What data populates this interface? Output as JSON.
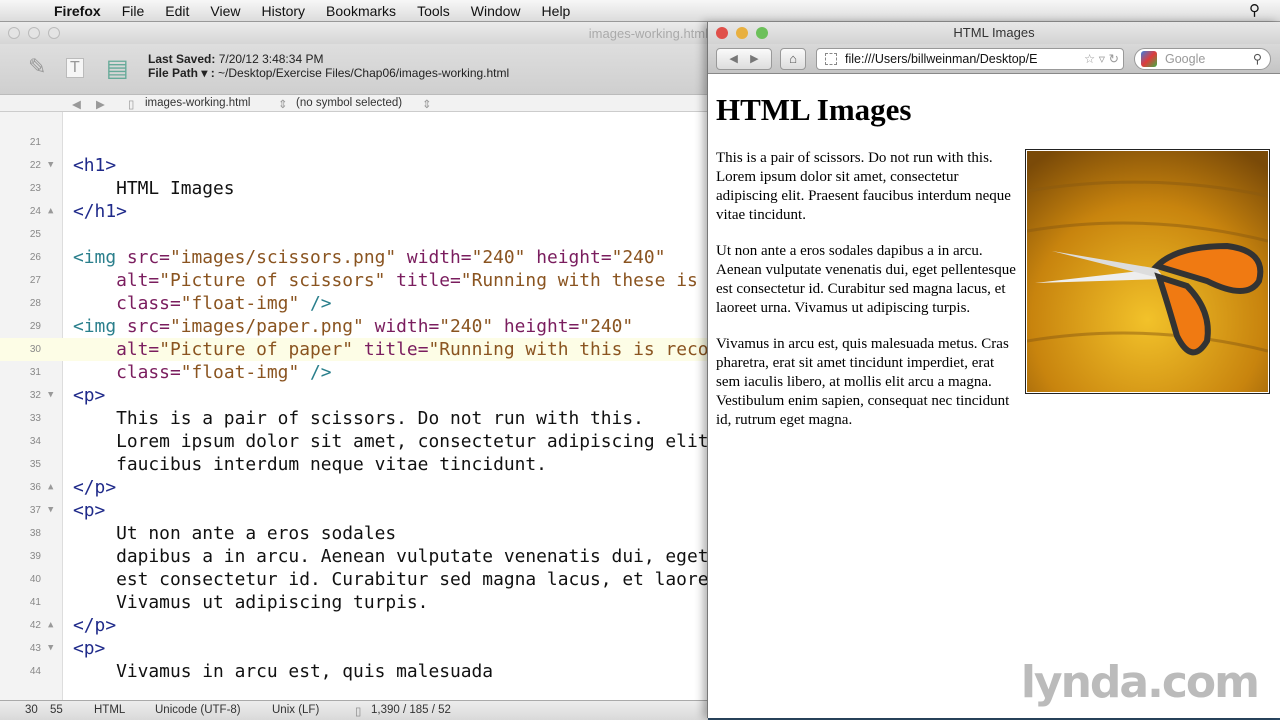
{
  "menubar": {
    "app": "Firefox",
    "items": [
      "File",
      "Edit",
      "View",
      "History",
      "Bookmarks",
      "Tools",
      "Window",
      "Help"
    ]
  },
  "editor": {
    "window_title": "images-working.html",
    "last_saved_label": "Last Saved:",
    "last_saved": "7/20/12 3:48:34 PM",
    "file_path_label": "File Path ▾ :",
    "file_path": "~/Desktop/Exercise Files/Chap06/images-working.html",
    "nav_file": "images-working.html",
    "nav_symbol": "(no symbol selected)",
    "current_line": 30,
    "lines": [
      {
        "n": 21,
        "fold": "",
        "t": []
      },
      {
        "n": 22,
        "fold": "▼",
        "t": [
          [
            "tag",
            "<h1>"
          ]
        ]
      },
      {
        "n": 23,
        "fold": "",
        "t": [
          [
            "text",
            "    HTML Images"
          ]
        ]
      },
      {
        "n": 24,
        "fold": "▲",
        "t": [
          [
            "tag",
            "</h1>"
          ]
        ]
      },
      {
        "n": 25,
        "fold": "",
        "t": []
      },
      {
        "n": 26,
        "fold": "",
        "t": [
          [
            "img",
            "<img "
          ],
          [
            "attr",
            "src="
          ],
          [
            "str",
            "\"images/scissors.png\" "
          ],
          [
            "attr",
            "width="
          ],
          [
            "str",
            "\"240\" "
          ],
          [
            "attr",
            "height="
          ],
          [
            "str",
            "\"240\""
          ]
        ]
      },
      {
        "n": 27,
        "fold": "",
        "t": [
          [
            "text",
            "    "
          ],
          [
            "attr",
            "alt="
          ],
          [
            "str",
            "\"Picture of scissors\" "
          ],
          [
            "attr",
            "title="
          ],
          [
            "str",
            "\"Running with these is"
          ]
        ]
      },
      {
        "n": 28,
        "fold": "",
        "t": [
          [
            "text",
            "    "
          ],
          [
            "attr",
            "class="
          ],
          [
            "str",
            "\"float-img\" "
          ],
          [
            "img",
            "/>"
          ]
        ]
      },
      {
        "n": 29,
        "fold": "",
        "t": [
          [
            "img",
            "<img "
          ],
          [
            "attr",
            "src="
          ],
          [
            "str",
            "\"images/paper.png\" "
          ],
          [
            "attr",
            "width="
          ],
          [
            "str",
            "\"240\" "
          ],
          [
            "attr",
            "height="
          ],
          [
            "str",
            "\"240\""
          ]
        ]
      },
      {
        "n": 30,
        "fold": "",
        "t": [
          [
            "text",
            "    "
          ],
          [
            "attr",
            "alt="
          ],
          [
            "str",
            "\"Picture of paper\" "
          ],
          [
            "attr",
            "title="
          ],
          [
            "str",
            "\"Running with this is reco"
          ]
        ]
      },
      {
        "n": 31,
        "fold": "",
        "t": [
          [
            "text",
            "    "
          ],
          [
            "attr",
            "class="
          ],
          [
            "str",
            "\"float-img\" "
          ],
          [
            "img",
            "/>"
          ]
        ]
      },
      {
        "n": 32,
        "fold": "▼",
        "t": [
          [
            "tag",
            "<p>"
          ]
        ]
      },
      {
        "n": 33,
        "fold": "",
        "t": [
          [
            "text",
            "    This is a pair of scissors. Do not run with this."
          ]
        ]
      },
      {
        "n": 34,
        "fold": "",
        "t": [
          [
            "text",
            "    Lorem ipsum dolor sit amet, consectetur adipiscing elit"
          ]
        ]
      },
      {
        "n": 35,
        "fold": "",
        "t": [
          [
            "text",
            "    faucibus interdum neque vitae tincidunt."
          ]
        ]
      },
      {
        "n": 36,
        "fold": "▲",
        "t": [
          [
            "tag",
            "</p>"
          ]
        ]
      },
      {
        "n": 37,
        "fold": "▼",
        "t": [
          [
            "tag",
            "<p>"
          ]
        ]
      },
      {
        "n": 38,
        "fold": "",
        "t": [
          [
            "text",
            "    Ut non ante a eros sodales"
          ]
        ]
      },
      {
        "n": 39,
        "fold": "",
        "t": [
          [
            "text",
            "    dapibus a in arcu. Aenean vulputate venenatis dui, eget"
          ]
        ]
      },
      {
        "n": 40,
        "fold": "",
        "t": [
          [
            "text",
            "    est consectetur id. Curabitur sed magna lacus, et laore"
          ]
        ]
      },
      {
        "n": 41,
        "fold": "",
        "t": [
          [
            "text",
            "    Vivamus ut adipiscing turpis."
          ]
        ]
      },
      {
        "n": 42,
        "fold": "▲",
        "t": [
          [
            "tag",
            "</p>"
          ]
        ]
      },
      {
        "n": 43,
        "fold": "▼",
        "t": [
          [
            "tag",
            "<p>"
          ]
        ]
      },
      {
        "n": 44,
        "fold": "",
        "t": [
          [
            "text",
            "    Vivamus in arcu est, quis malesuada"
          ]
        ]
      }
    ],
    "status": {
      "line": "30",
      "col": "55",
      "syntax": "HTML",
      "encoding": "Unicode (UTF-8)",
      "line_endings": "Unix (LF)",
      "stats": "1,390 / 185 / 52"
    }
  },
  "browser": {
    "window_title": "HTML Images",
    "url": "file:///Users/billweinman/Desktop/E",
    "search_placeholder": "Google",
    "heading": "HTML Images",
    "paragraphs": [
      "This is a pair of scissors. Do not run with this. Lorem ipsum dolor sit amet, consectetur adipiscing elit. Praesent faucibus interdum neque vitae tincidunt.",
      "Ut non ante a eros sodales dapibus a in arcu. Aenean vulputate venenatis dui, eget pellentesque est consectetur id. Curabitur sed magna lacus, et laoreet urna. Vivamus ut adipiscing turpis.",
      "Vivamus in arcu est, quis malesuada metus. Cras pharetra, erat sit amet tincidunt imperdiet, erat sem iaculis libero, at mollis elit arcu a magna. Vestibulum enim sapien, consequat nec tincidunt id, rutrum eget magna."
    ],
    "image_alt": "Picture of scissors"
  },
  "watermark": "lynda.com",
  "colors": {
    "tag": "#1f2a8a",
    "img_tag": "#2a7f8c",
    "attr": "#7a1d5e",
    "string": "#8a5420",
    "current_line": "#fdfde6"
  }
}
